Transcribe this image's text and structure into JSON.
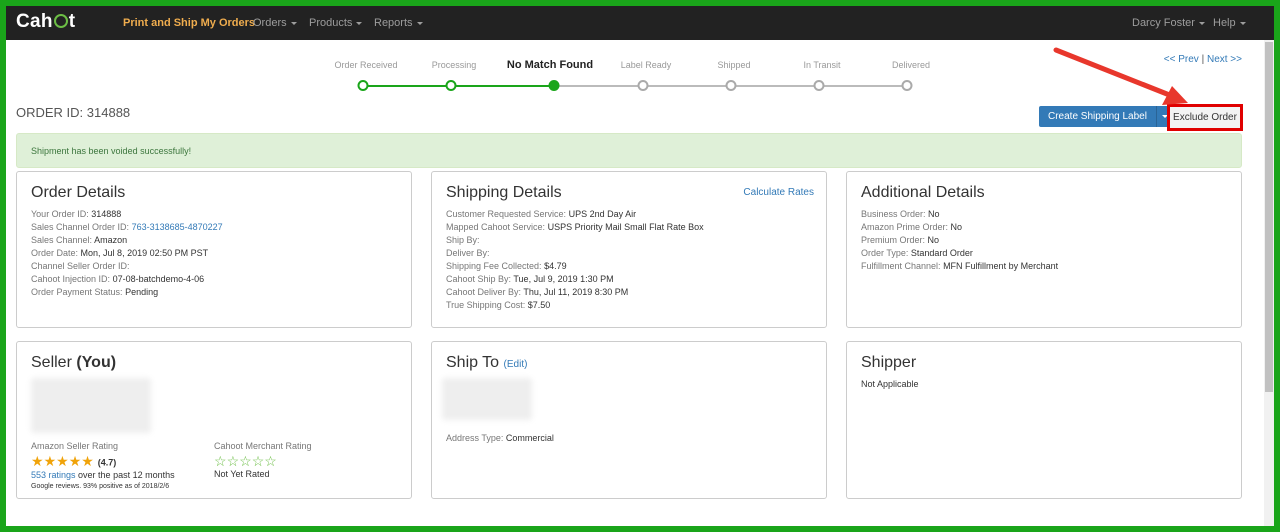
{
  "nav": {
    "logo": "Cahoot",
    "items": [
      {
        "label": "Print and Ship My Orders",
        "brand": true
      },
      {
        "label": "Orders",
        "caret": true
      },
      {
        "label": "Products",
        "caret": true
      },
      {
        "label": "Reports",
        "caret": true
      }
    ],
    "user": "Darcy Foster",
    "help": "Help"
  },
  "progress": {
    "steps": [
      {
        "label": "Order Received",
        "state": "done"
      },
      {
        "label": "Processing",
        "state": "done"
      },
      {
        "label": "No Match Found",
        "state": "current"
      },
      {
        "label": "Label Ready",
        "state": "pending"
      },
      {
        "label": "Shipped",
        "state": "pending"
      },
      {
        "label": "In Transit",
        "state": "pending"
      },
      {
        "label": "Delivered",
        "state": "pending"
      }
    ]
  },
  "pager": {
    "prev": "<< Prev",
    "sep": "|",
    "next": "Next >>"
  },
  "order_id_label": "ORDER ID: 314888",
  "actions": {
    "create_label": "Create Shipping Label",
    "exclude": "Exclude Order"
  },
  "alert": "Shipment has been voided successfully!",
  "order_details": {
    "title": "Order Details",
    "rows": [
      {
        "k": "Your Order ID:",
        "v": "314888"
      },
      {
        "k": "Sales Channel Order ID:",
        "v": "763-3138685-4870227",
        "link": true
      },
      {
        "k": "Sales Channel:",
        "v": "Amazon"
      },
      {
        "k": "Order Date:",
        "v": "Mon, Jul 8, 2019 02:50 PM PST"
      },
      {
        "k": "Channel Seller Order ID:",
        "v": ""
      },
      {
        "k": "Cahoot Injection ID:",
        "v": "07-08-batchdemo-4-06"
      },
      {
        "k": "Order Payment Status:",
        "v": "Pending"
      }
    ]
  },
  "shipping_details": {
    "title": "Shipping Details",
    "link": "Calculate Rates",
    "rows": [
      {
        "k": "Customer Requested Service:",
        "v": "UPS 2nd Day Air"
      },
      {
        "k": "Mapped Cahoot Service:",
        "v": "USPS Priority Mail Small Flat Rate Box"
      },
      {
        "k": "Ship By:",
        "v": ""
      },
      {
        "k": "Deliver By:",
        "v": ""
      },
      {
        "k": "Shipping Fee Collected:",
        "v": "$4.79"
      },
      {
        "k": "Cahoot Ship By:",
        "v": "Tue, Jul 9, 2019 1:30 PM"
      },
      {
        "k": "Cahoot Deliver By:",
        "v": "Thu, Jul 11, 2019 8:30 PM"
      },
      {
        "k": "True Shipping Cost:",
        "v": "$7.50"
      }
    ]
  },
  "additional_details": {
    "title": "Additional Details",
    "rows": [
      {
        "k": "Business Order:",
        "v": "No"
      },
      {
        "k": "Amazon Prime Order:",
        "v": "No"
      },
      {
        "k": "Premium Order:",
        "v": "No"
      },
      {
        "k": "Order Type:",
        "v": "Standard Order"
      },
      {
        "k": "Fulfillment Channel:",
        "v": "MFN Fulfillment by Merchant"
      }
    ]
  },
  "seller": {
    "title": "Seller",
    "title_bold": "(You)",
    "amazon_rating_label": "Amazon Seller Rating",
    "amazon_stars": 5,
    "amazon_score": "(4.7)",
    "ratings_count": "553 ratings",
    "ratings_period": "over the past 12 months",
    "google_note": "Google reviews. 93% positive as of 2018/2/6",
    "cahoot_rating_label": "Cahoot Merchant Rating",
    "cahoot_stars": 0,
    "cahoot_note": "Not Yet Rated"
  },
  "ship_to": {
    "title": "Ship To",
    "edit": "(Edit)",
    "address_type_label": "Address Type:",
    "address_type": "Commercial"
  },
  "shipper": {
    "title": "Shipper",
    "value": "Not Applicable"
  },
  "colors": {
    "frame": "#1aa51a",
    "navbar": "#222222",
    "brand": "#f0ad4e",
    "primary": "#337ab7",
    "alert_bg": "#dff0d8",
    "alert_text": "#3c763d",
    "highlight": "#e00000",
    "star": "#f0a30a"
  }
}
